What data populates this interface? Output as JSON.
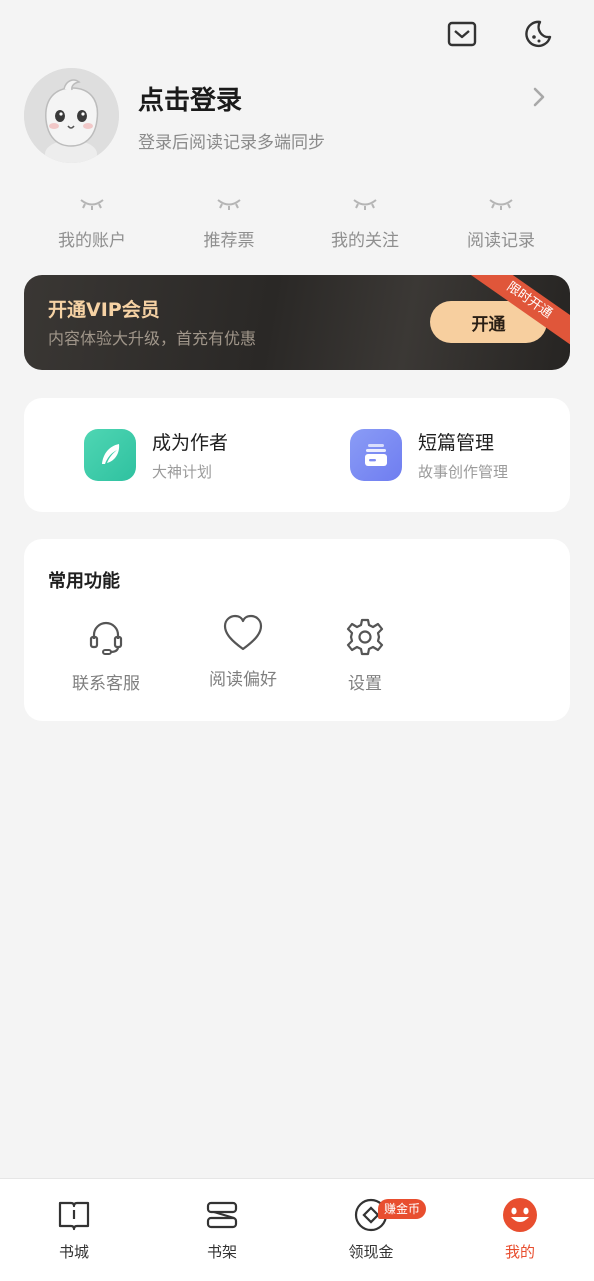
{
  "header": {
    "icons": [
      "mailbox-icon",
      "night-mode-icon"
    ]
  },
  "profile": {
    "title": "点击登录",
    "subtitle": "登录后阅读记录多端同步"
  },
  "stats": [
    {
      "label": "我的账户"
    },
    {
      "label": "推荐票"
    },
    {
      "label": "我的关注"
    },
    {
      "label": "阅读记录"
    }
  ],
  "vip": {
    "title": "开通VIP会员",
    "subtitle": "内容体验大升级，首充有优惠",
    "button": "开通",
    "ribbon": "限时开通"
  },
  "creator": {
    "author": {
      "title": "成为作者",
      "subtitle": "大神计划"
    },
    "short": {
      "title": "短篇管理",
      "subtitle": "故事创作管理"
    }
  },
  "functions": {
    "title": "常用功能",
    "items": [
      {
        "label": "联系客服",
        "icon": "headset-icon"
      },
      {
        "label": "阅读偏好",
        "icon": "heart-icon"
      },
      {
        "label": "设置",
        "icon": "gear-icon"
      }
    ]
  },
  "nav": {
    "items": [
      {
        "label": "书城",
        "icon": "book-icon"
      },
      {
        "label": "书架",
        "icon": "bookshelf-icon"
      },
      {
        "label": "领现金",
        "icon": "coin-icon"
      },
      {
        "label": "我的",
        "icon": "smile-icon"
      }
    ],
    "badge": "赚金币",
    "active_color": "#e84e2f"
  }
}
